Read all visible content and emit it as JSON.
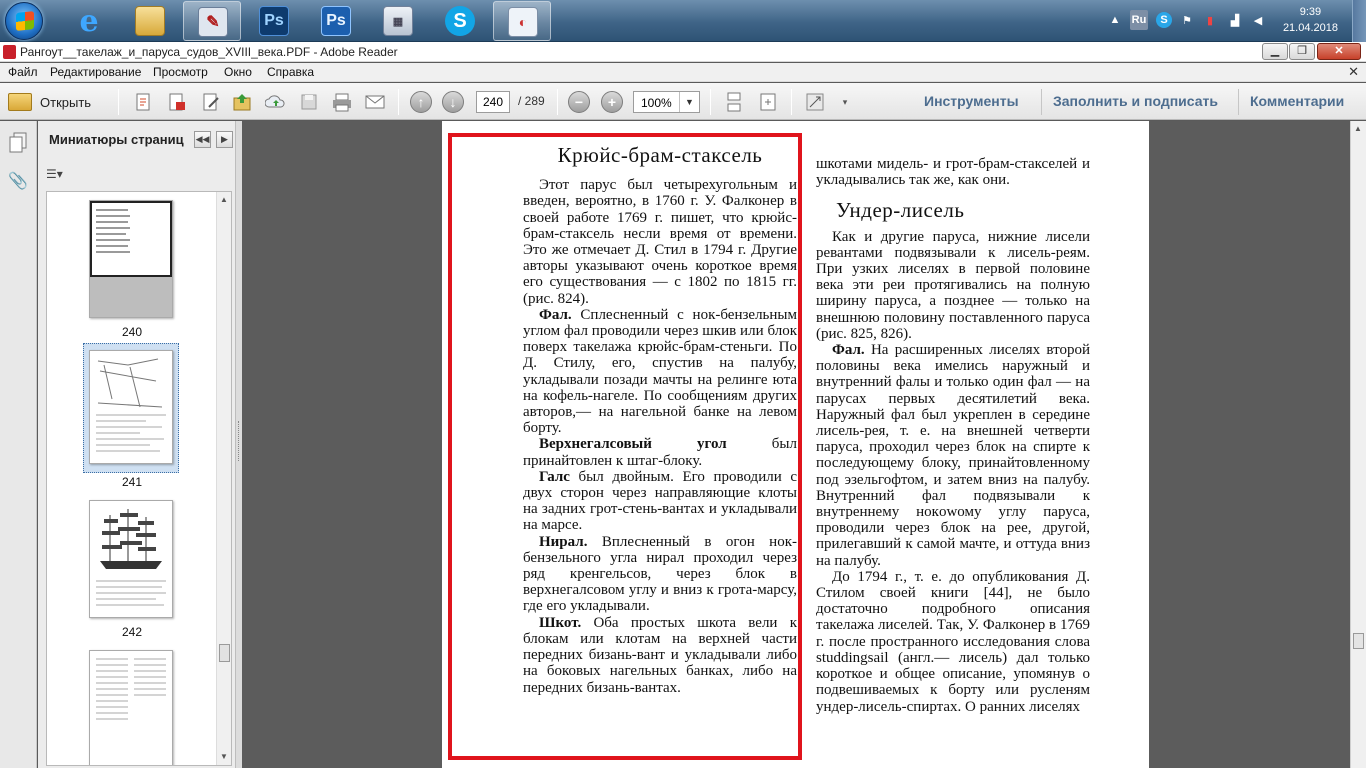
{
  "taskbar": {
    "apps": [
      {
        "name": "internet-explorer",
        "glyph": "e",
        "color": "#1e8ee0"
      },
      {
        "name": "file-explorer",
        "glyph": "",
        "color": "#e9c76a"
      },
      {
        "name": "adobe-reader",
        "glyph": "",
        "color": "#8e9bb0"
      },
      {
        "name": "photoshop-1",
        "glyph": "Ps",
        "color": "#1b4e8c"
      },
      {
        "name": "photoshop-2",
        "glyph": "Ps",
        "color": "#1b4e8c"
      },
      {
        "name": "calculator",
        "glyph": "",
        "color": "#d0d4db"
      },
      {
        "name": "skype",
        "glyph": "S",
        "color": "#12a5e6"
      },
      {
        "name": "paint",
        "glyph": "",
        "color": "#e7eef6"
      }
    ],
    "tray": {
      "lang": "Ru",
      "time": "9:39",
      "date": "21.04.2018"
    }
  },
  "window": {
    "title": "Рангоут__такелаж_и_паруса_судов_XVIII_века.PDF - Adobe Reader"
  },
  "menu": [
    "Файл",
    "Редактирование",
    "Просмотр",
    "Окно",
    "Справка"
  ],
  "toolbar": {
    "open_label": "Открыть",
    "page_current": "240",
    "page_total": "/ 289",
    "zoom": "100%",
    "tools": "Инструменты",
    "fill_sign": "Заполнить и подписать",
    "comments": "Комментарии"
  },
  "panel": {
    "title": "Миниатюры страниц",
    "thumbnails": [
      {
        "label": "240",
        "selected": false
      },
      {
        "label": "241",
        "selected": true
      },
      {
        "label": "242",
        "selected": false
      }
    ]
  },
  "document": {
    "left_heading": "Крюйс-брам-стаксель",
    "left_p1": "Этот парус был четырехугольным и введен, вероятно, в 1760 г. У. Фалконер в своей работе 1769 г. пишет, что крюйс-брам-стаксель несли время от времени. Это же отмечает Д. Стил в 1794 г. Другие авторы указывают очень короткое время его существования — с 1802 по 1815 гг. (рис. 824).",
    "left_p2_bold": "Фал.",
    "left_p2": " Сплесненный с нок-бензельным углом фал проводили через шкив или блок поверх такелажа крюйс-брам-стеньги. По Д. Стилу, его, спустив на палубу, укладывали позади мачты на релинге юта на кофель-нагеле. По сообщениям других авторов,— на нагельной банке на левом борту.",
    "left_p3_bold": "Верхнегалсовый угол",
    "left_p3": " был принайтовлен к штаг-блоку.",
    "left_p4_bold": "Галс",
    "left_p4": " был двойным. Его проводили с двух сторон через направляющие клоты на задних грот-стень-вантах и укладывали на марсе.",
    "left_p5_bold": "Нирал.",
    "left_p5": " Вплесненный в огон нок-бензельного угла нирал проходил через ряд кренгельсов, через блок в верхнегалсовом углу и вниз к грота-марсу, где его укладывали.",
    "left_p6_bold": "Шкот.",
    "left_p6": " Оба простых шкота вели к блокам или клотам на верхней части передних бизань-вант и укладывали либо на боковых нагельных банках, либо на передних бизань-вантах.",
    "right_p0": "шкотами мидель- и грот-брам-стакселей и укладывались так же, как они.",
    "right_heading": "Ундер-лисель",
    "right_p1": "Как и другие паруса, нижние лисели ревантами подвязывали к лисель-реям. При узких лиселях в первой половине века эти реи протягивались на полную ширину паруса, а позднее — только на внешнюю половину поставленного паруса (рис. 825, 826).",
    "right_p2_bold": "Фал.",
    "right_p2": " На расширенных лиселях второй половины века имелись наружный и внутренний фалы и только один фал — на парусах первых десятилетий века. Наружный фал был укреплен в середине лисель-рея, т. е. на внешней четверти паруса, проходил через блок на спирте к последующему блоку, принайтовленному под эзельгофтом, и затем вниз на палубу. Внутренний фал подвязывали к внутреннему нокowому углу паруса, проводили через блок на рее, другой, прилегавший к самой мачте, и оттуда вниз на палубу.",
    "right_p3": "До 1794 г., т. е. до опубликования Д. Стилом своей книги [44], не было достаточно подробного описания такелажа лиселей. Так, У. Фалконер в 1769 г. после пространного исследования слова studdingsail (англ.— лисель) дал только короткое и общее описание, упомянув о подвешиваемых к борту или русленям ундер-лисель-спиртах. О ранних лиселях"
  },
  "colors": {
    "highlight_box": "#e0141c",
    "link_blue": "#4d6d8f"
  }
}
